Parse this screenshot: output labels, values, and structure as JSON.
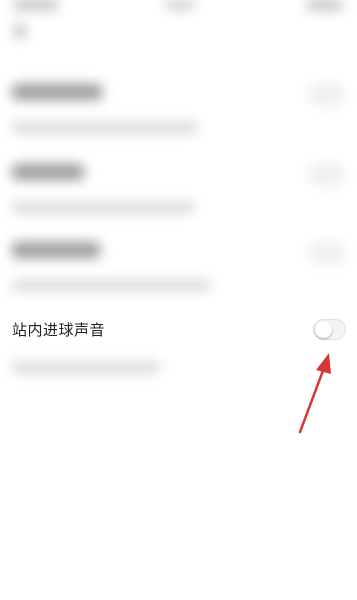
{
  "setting": {
    "label": "站内进球声音",
    "toggle_state": "off"
  },
  "colors": {
    "annotation_arrow": "#d6373b",
    "toggle_off_bg": "#f4f4f4",
    "label_text": "#222222"
  },
  "icons": {
    "annotation": "red-arrow-icon"
  }
}
